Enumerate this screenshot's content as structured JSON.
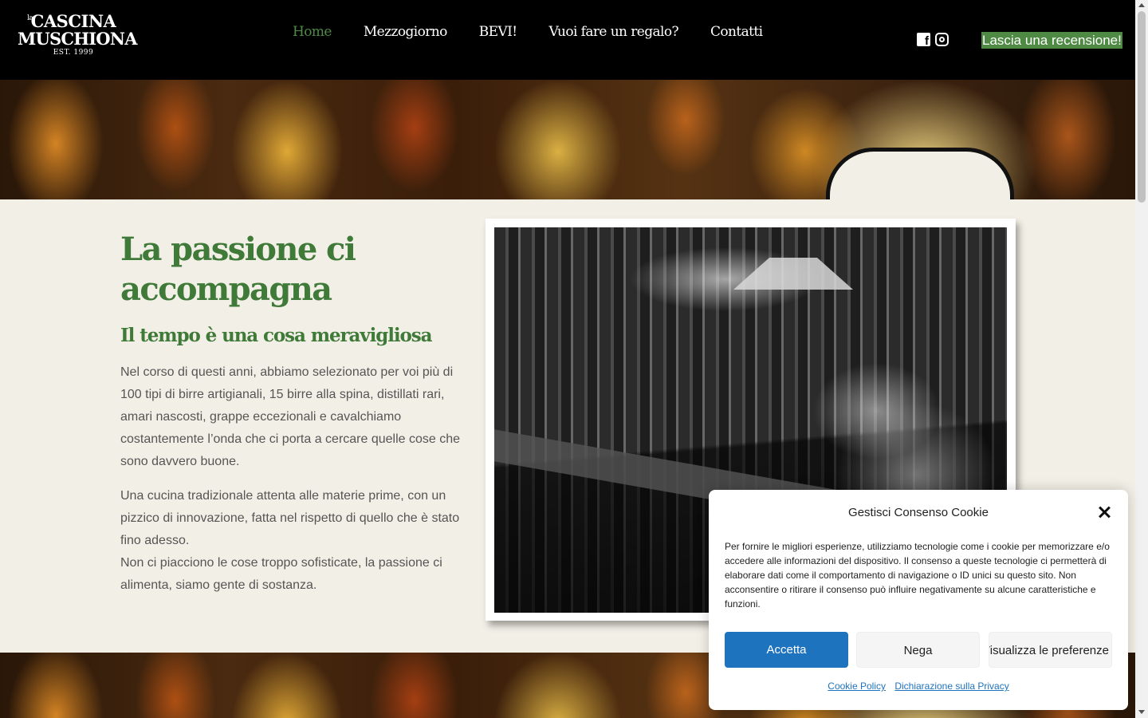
{
  "header": {
    "logo": {
      "line1": "CASCINA",
      "small": "la",
      "line2": "MUSCHIONA",
      "line3": "EST. 1999"
    },
    "nav": [
      {
        "label": "Home",
        "active": true
      },
      {
        "label": "Mezzogiorno"
      },
      {
        "label": "BEVI!"
      },
      {
        "label": "Vuoi fare un regalo?"
      },
      {
        "label": "Contatti"
      }
    ],
    "social": [
      "facebook-icon",
      "instagram-icon"
    ],
    "review_button": "Lascia una recensione!"
  },
  "colors": {
    "accent_green": "#3f7a39",
    "nav_active": "#4e8a44",
    "header_bg": "#000000",
    "page_bg": "#f2efe6",
    "cookie_accept": "#1e73be"
  },
  "main": {
    "title": "La passione ci accompagna",
    "subtitle": "Il tempo è una cosa meravigliosa",
    "paragraph1": "Nel corso di questi anni, abbiamo selezionato per voi più di 100 tipi di birre artigianali, 15 birre alla spina, distillati rari, amari nascosti, grappe eccezionali e cavalchiamo costantemente l’onda che ci porta a cercare quelle cose che sono davvero buone.",
    "paragraph2a": "Una cucina tradizionale attenta alle materie prime, con un pizzico di innovazione, fatta nel rispetto di quello che è stato fino adesso.",
    "paragraph2b": "Non ci piacciono le cose troppo sofisticate, la passione ci alimenta, siamo gente di sostanza."
  },
  "cookie": {
    "title": "Gestisci Consenso Cookie",
    "text": "Per fornire le migliori esperienze, utilizziamo tecnologie come i cookie per memorizzare e/o accedere alle informazioni del dispositivo. Il consenso a queste tecnologie ci permetterà di elaborare dati come il comportamento di navigazione o ID unici su questo sito. Non acconsentire o ritirare il consenso può influire negativamente su alcune caratteristiche e funzioni.",
    "accept": "Accetta",
    "deny": "Nega",
    "preferences": "Visualizza le preferenze",
    "link_cookie_policy": "Cookie Policy",
    "link_privacy": "Dichiarazione sulla Privacy"
  }
}
